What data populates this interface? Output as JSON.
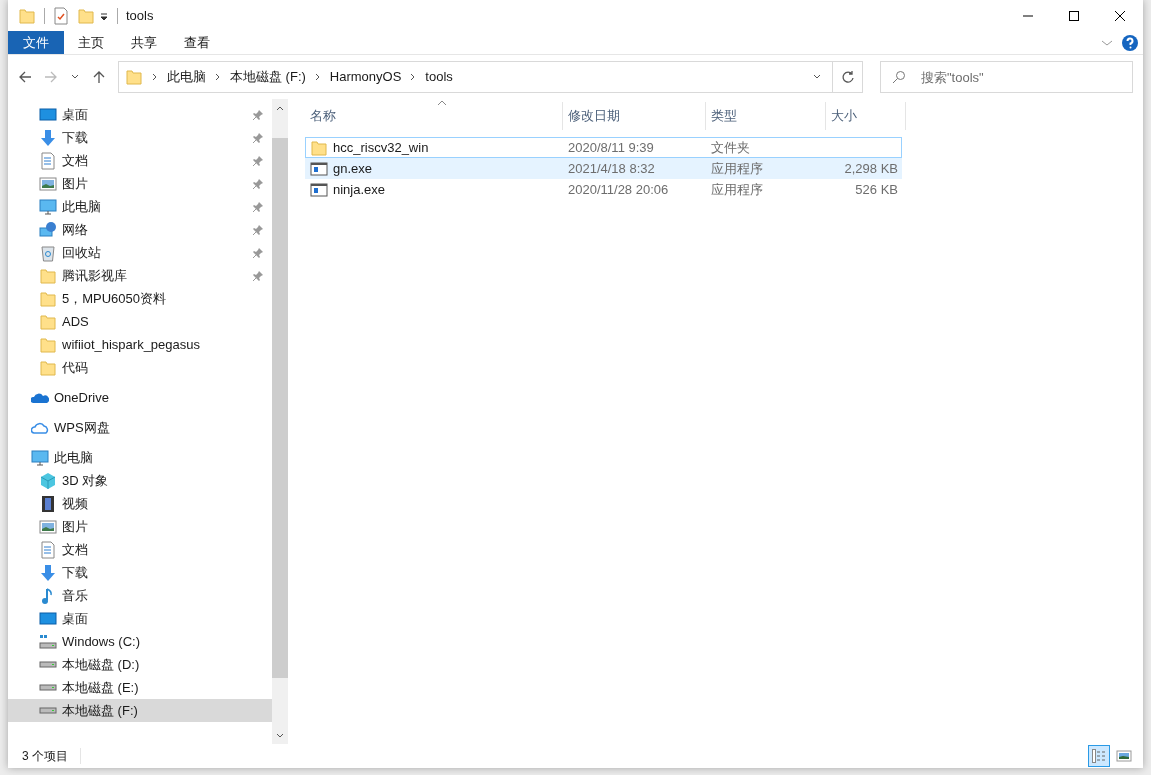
{
  "window": {
    "title": "tools"
  },
  "ribbon": {
    "tabs": [
      {
        "label": "文件",
        "kind": "file"
      },
      {
        "label": "主页",
        "kind": "tab"
      },
      {
        "label": "共享",
        "kind": "tab"
      },
      {
        "label": "查看",
        "kind": "tab"
      }
    ]
  },
  "address_bar": {
    "path": [
      "此电脑",
      "本地磁盘 (F:)",
      "HarmonyOS",
      "tools"
    ]
  },
  "search": {
    "placeholder": "搜索\"tools\""
  },
  "sidebar": {
    "quick_access": [
      {
        "label": "桌面",
        "kind": "desktop",
        "pinned": true
      },
      {
        "label": "下载",
        "kind": "download",
        "pinned": true
      },
      {
        "label": "文档",
        "kind": "document",
        "pinned": true
      },
      {
        "label": "图片",
        "kind": "picture",
        "pinned": true
      },
      {
        "label": "此电脑",
        "kind": "pc",
        "pinned": true
      },
      {
        "label": "网络",
        "kind": "network",
        "pinned": true
      },
      {
        "label": "回收站",
        "kind": "recycle",
        "pinned": true
      },
      {
        "label": "腾讯影视库",
        "kind": "folder",
        "pinned": true
      },
      {
        "label": "5，MPU6050资料",
        "kind": "folder",
        "pinned": false
      },
      {
        "label": "ADS",
        "kind": "folder",
        "pinned": false
      },
      {
        "label": "wifiiot_hispark_pegasus",
        "kind": "folder",
        "pinned": false
      },
      {
        "label": "代码",
        "kind": "folder",
        "pinned": false
      }
    ],
    "items": [
      {
        "label": "OneDrive",
        "kind": "onedrive",
        "selected": false
      },
      {
        "label": "WPS网盘",
        "kind": "cloud",
        "selected": false
      },
      {
        "label": "此电脑",
        "kind": "pc",
        "selected": false,
        "children": [
          {
            "label": "3D 对象",
            "kind": "cube",
            "selected": false
          },
          {
            "label": "视频",
            "kind": "video",
            "selected": false
          },
          {
            "label": "图片",
            "kind": "picture",
            "selected": false
          },
          {
            "label": "文档",
            "kind": "document",
            "selected": false
          },
          {
            "label": "下载",
            "kind": "download",
            "selected": false
          },
          {
            "label": "音乐",
            "kind": "music",
            "selected": false
          },
          {
            "label": "桌面",
            "kind": "desktop",
            "selected": false
          },
          {
            "label": "Windows (C:)",
            "kind": "windrive",
            "selected": false
          },
          {
            "label": "本地磁盘 (D:)",
            "kind": "drive",
            "selected": false
          },
          {
            "label": "本地磁盘 (E:)",
            "kind": "drive",
            "selected": false
          },
          {
            "label": "本地磁盘 (F:)",
            "kind": "drive",
            "selected": true
          }
        ]
      }
    ]
  },
  "table": {
    "columns": [
      "名称",
      "修改日期",
      "类型",
      "大小"
    ],
    "rows": [
      {
        "name": "hcc_riscv32_win",
        "kind": "folder",
        "date": "2020/8/11 9:39",
        "type": "文件夹",
        "focused": true,
        "hovered": false
      },
      {
        "name": "gn.exe",
        "kind": "exe",
        "date": "2021/4/18 8:32",
        "type": "应用程序",
        "size": "2,298 KB",
        "focused": false,
        "hovered": true
      },
      {
        "name": "ninja.exe",
        "kind": "exe",
        "date": "2020/11/28 20:06",
        "type": "应用程序",
        "size": "526 KB",
        "focused": false,
        "hovered": false
      }
    ]
  },
  "status_bar": {
    "count": "3 个项目",
    "views": [
      {
        "kind": "details",
        "selected": true
      },
      {
        "kind": "thumbnails",
        "selected": false
      }
    ]
  }
}
